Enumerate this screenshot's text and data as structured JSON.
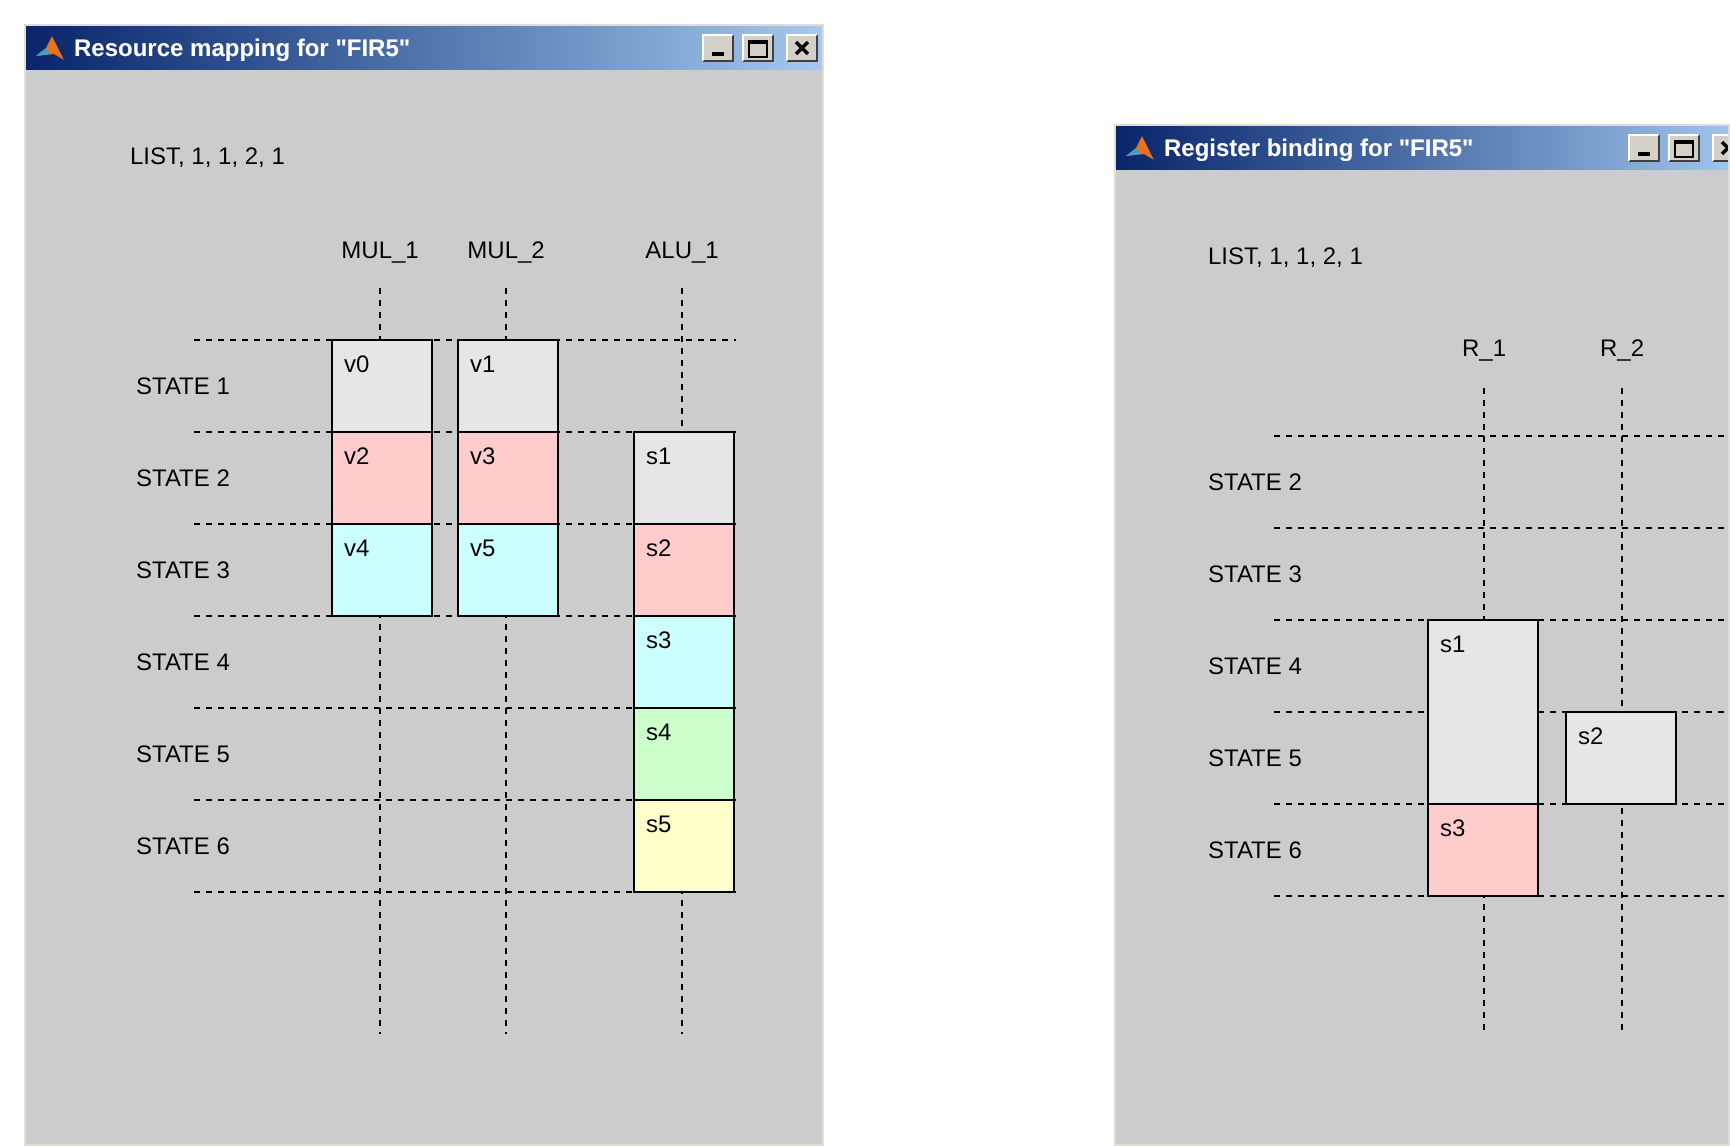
{
  "windows": [
    {
      "title": "Resource mapping for \"FIR5\"",
      "list_text": "LIST, 1, 1, 2, 1",
      "columns": [
        "MUL_1",
        "MUL_2",
        "ALU_1"
      ],
      "rows": [
        {
          "label": "STATE 1",
          "cells": [
            {
              "kind": "block",
              "label": "v0",
              "color": "#e6e6e6"
            },
            {
              "kind": "block",
              "label": "v1",
              "color": "#e6e6e6"
            },
            {
              "kind": "empty"
            }
          ]
        },
        {
          "label": "STATE 2",
          "cells": [
            {
              "kind": "block",
              "label": "v2",
              "color": "#ffcccc"
            },
            {
              "kind": "block",
              "label": "v3",
              "color": "#ffcccc"
            },
            {
              "kind": "block",
              "label": "s1",
              "color": "#e6e6e6"
            }
          ]
        },
        {
          "label": "STATE 3",
          "cells": [
            {
              "kind": "block",
              "label": "v4",
              "color": "#ccffff"
            },
            {
              "kind": "block",
              "label": "v5",
              "color": "#ccffff"
            },
            {
              "kind": "block",
              "label": "s2",
              "color": "#ffcccc"
            }
          ]
        },
        {
          "label": "STATE 4",
          "cells": [
            {
              "kind": "empty"
            },
            {
              "kind": "empty"
            },
            {
              "kind": "block",
              "label": "s3",
              "color": "#ccffff"
            }
          ]
        },
        {
          "label": "STATE 5",
          "cells": [
            {
              "kind": "empty"
            },
            {
              "kind": "empty"
            },
            {
              "kind": "block",
              "label": "s4",
              "color": "#ccffcc"
            }
          ]
        },
        {
          "label": "STATE 6",
          "cells": [
            {
              "kind": "empty"
            },
            {
              "kind": "empty"
            },
            {
              "kind": "block",
              "label": "s5",
              "color": "#ffffcc"
            }
          ]
        }
      ]
    },
    {
      "title": "Register binding for \"FIR5\"",
      "list_text": "LIST, 1, 1, 2, 1",
      "columns": [
        "R_1",
        "R_2"
      ],
      "rows": [
        {
          "label": "STATE 2",
          "cells": [
            {
              "kind": "empty"
            },
            {
              "kind": "empty"
            }
          ]
        },
        {
          "label": "STATE 3",
          "cells": [
            {
              "kind": "empty"
            },
            {
              "kind": "empty"
            }
          ]
        },
        {
          "label": "STATE 4",
          "cells": [
            {
              "kind": "block",
              "label": "s1",
              "color": "#e6e6e6"
            },
            {
              "kind": "empty"
            }
          ]
        },
        {
          "label": "STATE 5",
          "cells": [
            {
              "kind": "continued"
            },
            {
              "kind": "block",
              "label": "s2",
              "color": "#e6e6e6"
            }
          ]
        },
        {
          "label": "STATE 6",
          "cells": [
            {
              "kind": "block",
              "label": "s3",
              "color": "#ffcccc"
            },
            {
              "kind": "empty"
            }
          ]
        }
      ]
    }
  ]
}
